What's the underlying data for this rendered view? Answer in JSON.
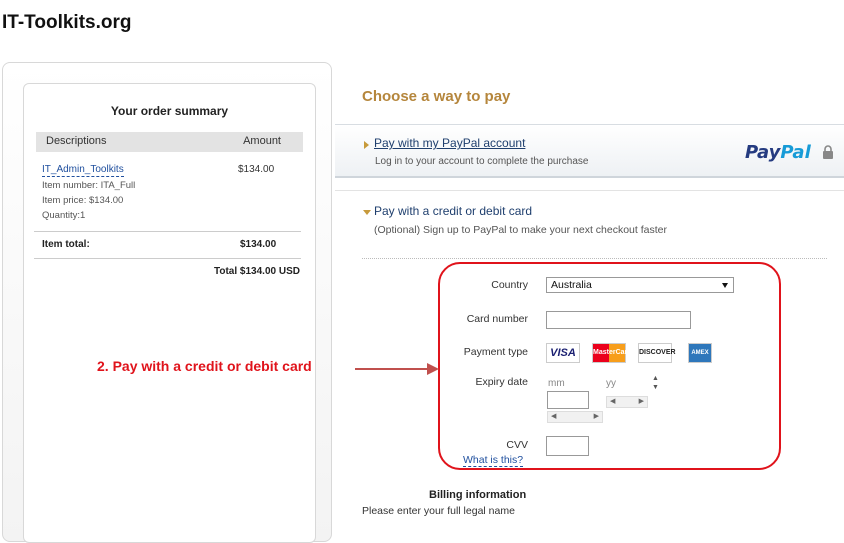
{
  "site": {
    "title": "IT-Toolkits.org"
  },
  "order_summary": {
    "title": "Your order summary",
    "col_descriptions": "Descriptions",
    "col_amount": "Amount",
    "item": {
      "name": "IT_Admin_Toolkits",
      "amount": "$134.00",
      "number_line": "Item number: ITA_Full",
      "price_line": "Item price: $134.00",
      "quantity_line": "Quantity:1"
    },
    "item_total_label": "Item total:",
    "item_total_value": "$134.00",
    "grand_total": "Total $134.00 USD"
  },
  "payment": {
    "heading": "Choose a way to pay",
    "paypal": {
      "link": "Pay with my PayPal account",
      "subtitle": "Log in to your account to complete the purchase",
      "logo_part1": "Pay",
      "logo_part2": "Pal"
    },
    "card": {
      "title": "Pay with a credit or debit card",
      "subtitle": "(Optional) Sign up to PayPal to make your next checkout faster",
      "country_label": "Country",
      "country_value": "Australia",
      "card_number_label": "Card number",
      "payment_type_label": "Payment type",
      "card_types": [
        "VISA",
        "MasterCard",
        "DISCOVER",
        "AMEX"
      ],
      "expiry_label": "Expiry date",
      "expiry_mm": "mm",
      "expiry_yy": "yy",
      "cvv_label": "CVV",
      "what_is_this": "What is this?"
    },
    "billing": {
      "title": "Billing information",
      "subtitle": "Please enter your full legal name"
    }
  },
  "annotation": {
    "text": "2. Pay with a credit or debit card",
    "color": "#e0131b"
  },
  "colors": {
    "heading_gold": "#b5863c",
    "link_blue": "#1f3f6e",
    "paypal_dark": "#253b80",
    "paypal_light": "#179bd7"
  }
}
